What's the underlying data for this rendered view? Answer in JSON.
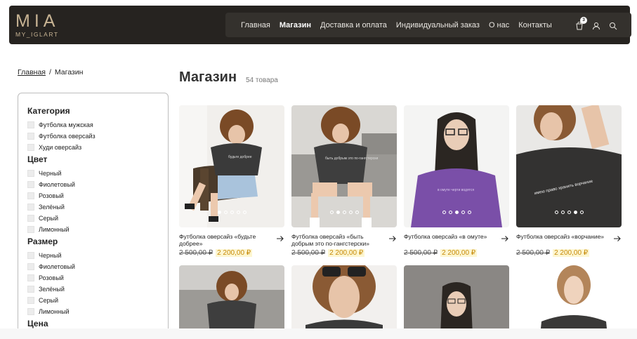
{
  "header": {
    "logo_main": "MIA",
    "logo_sub": "MY_IGLART",
    "nav": [
      "Главная",
      "Магазин",
      "Доставка и оплата",
      "Индивидуальный заказ",
      "О нас",
      "Контакты"
    ],
    "active_nav": "Магазин",
    "cart_count": "3",
    "icons": [
      "cart-icon",
      "user-icon",
      "search-icon"
    ]
  },
  "breadcrumb": {
    "home": "Главная",
    "separator": "/",
    "current": "Магазин"
  },
  "sidebar": {
    "categories_title": "Категория",
    "categories": [
      "Футболка мужская",
      "Футболка оверсайз",
      "Худи оверсайз"
    ],
    "color_title": "Цвет",
    "colors": [
      "Черный",
      "Фиолетовый",
      "Розовый",
      "Зелёный",
      "Серый",
      "Лимонный"
    ],
    "size_title": "Размер",
    "sizes": [
      "Черный",
      "Фиолетовый",
      "Розовый",
      "Зелёный",
      "Серый",
      "Лимонный"
    ],
    "price_title": "Цена"
  },
  "main": {
    "title": "Магазин",
    "count": "54 товара",
    "products": [
      {
        "title": "Футболка оверсайз «будьте добрее»",
        "old_price": "2 500,00 ₽",
        "new_price": "2 200,00 ₽"
      },
      {
        "title": "Футболка оверсайз «быть добрым это по-гангстерски»",
        "old_price": "2 500,00 ₽",
        "new_price": "2 200,00 ₽"
      },
      {
        "title": "Футболка оверсайз «в омуте»",
        "old_price": "2 500,00 ₽",
        "new_price": "2 200,00 ₽"
      },
      {
        "title": "Футболка оверсайз «ворчание»",
        "old_price": "2 500,00 ₽",
        "new_price": "2 200,00 ₽"
      }
    ],
    "shirt_prints": [
      "будьте добрее",
      "быть добрым это по-гангстерски",
      "в омуте черти водятся",
      "имею право хранить ворчание"
    ]
  },
  "colors": {
    "header_bg": "#262320",
    "navbar_bg": "#34312d",
    "logo": "#c7b393",
    "sale_text": "#c78a09",
    "sale_bg": "#fdf6d1"
  }
}
